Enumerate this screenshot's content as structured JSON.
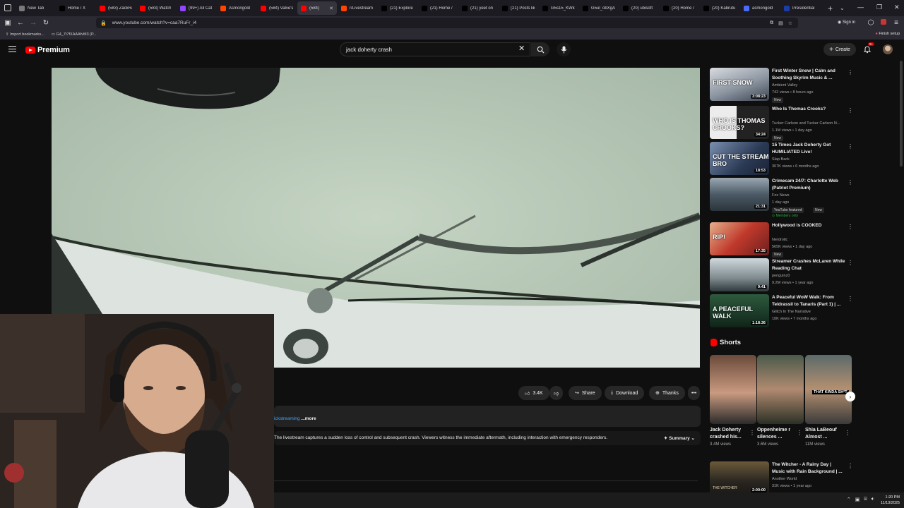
{
  "browser": {
    "tabs": [
      {
        "label": "New Tab",
        "color": "#7a7a7a",
        "active": false
      },
      {
        "label": "Home / X",
        "color": "#000000",
        "active": false
      },
      {
        "label": "(583) ZackRa",
        "color": "#ff0000",
        "active": false
      },
      {
        "label": "(583) Watch",
        "color": "#ff0000",
        "active": false
      },
      {
        "label": "(99+) All Cat",
        "color": "#9146ff",
        "active": false
      },
      {
        "label": "Asmongold",
        "color": "#ff4500",
        "active": false
      },
      {
        "label": "(584) Valve's",
        "color": "#ff0000",
        "active": false
      },
      {
        "label": "(584)",
        "color": "#ff0000",
        "active": true
      },
      {
        "label": "r/Livestream",
        "color": "#ff4500",
        "active": false
      },
      {
        "label": "(21) Explore",
        "color": "#000000",
        "active": false
      },
      {
        "label": "(21) Home /",
        "color": "#000000",
        "active": false
      },
      {
        "label": "(21) yeet on",
        "color": "#000000",
        "active": false
      },
      {
        "label": "(21) Posts lik",
        "color": "#000000",
        "active": false
      },
      {
        "label": "G5s15_KWk",
        "color": "#000000",
        "active": false
      },
      {
        "label": "G5ul_obXgA",
        "color": "#000000",
        "active": false
      },
      {
        "label": "(20) ubisoft",
        "color": "#000000",
        "active": false
      },
      {
        "label": "(20) Home /",
        "color": "#000000",
        "active": false
      },
      {
        "label": "(20) Kabrutu",
        "color": "#000000",
        "active": false
      },
      {
        "label": "asmongold",
        "color": "#4a6cf7",
        "active": false
      },
      {
        "label": "Presidential",
        "color": "#1a3da8",
        "active": false
      }
    ],
    "url": "www.youtube.com/watch?v=caa7RuFr_i4",
    "sign_in": "Sign in",
    "bookmarks": [
      "Import bookmarks...",
      "G4_7t7fXAAAfvM3 (P..."
    ],
    "finish_setup": "Finish setup"
  },
  "youtube": {
    "logo_text": "Premium",
    "search_query": "jack doherty crash",
    "create_label": "Create",
    "notif_count": "9+"
  },
  "video": {
    "actions": {
      "likes": "3.4K",
      "share": "Share",
      "download": "Download",
      "thanks": "Thanks"
    },
    "description_link": "ickstreaming",
    "description_more": " ...more",
    "summary_text": "The livestream captures a sudden loss of control and subsequent crash. Viewers witness the immediate aftermath, including interaction with emergency responders.",
    "summary_button": "Summary"
  },
  "recommendations": [
    {
      "title": "First Winter Snow | Calm and Soothing Skyrim Music & ...",
      "channel": "Ambient Valley",
      "meta": "742 views • 8 hours ago",
      "badge": "New",
      "duration": "3:08:23",
      "thumb_text": "FIRST SNOW"
    },
    {
      "title": "Who Is Thomas Crooks?",
      "channel": "Tucker Carlson and Tucker Carlson N...",
      "meta": "1.1M views • 1 day ago",
      "badge": "New",
      "duration": "34:24",
      "thumb_text": "WHO IS THOMAS CROOKS?"
    },
    {
      "title": "15 Times Jack Doherty Got HUMILIATED Live!",
      "channel": "Slap Back",
      "meta": "307K views • 6 months ago",
      "badge": "",
      "duration": "18:53",
      "thumb_text": "CUT THE STREAM BRO"
    },
    {
      "title": "Crimecam 24/7: Charlotte Web (Patriot Premium)",
      "channel": "Fox News",
      "meta": "1 day ago",
      "badge": "YouTube featured",
      "badge2": "New",
      "badge3": "Members only",
      "duration": "21:31",
      "thumb_text": ""
    },
    {
      "title": "Hollywood is COOKED",
      "channel": "Nerdrotic",
      "meta": "565K views • 1 day ago",
      "badge": "New",
      "duration": "17:35",
      "thumb_text": "RIP!"
    },
    {
      "title": "Streamer Crashes McLaren While Reading Chat",
      "channel": "penguinz0",
      "meta": "9.2M views • 1 year ago",
      "badge": "",
      "duration": "9:41",
      "thumb_text": ""
    },
    {
      "title": "A Peaceful WoW Walk: From Teldrassil to Tanaris (Part 1) | ...",
      "channel": "Glitch In The Narrative",
      "meta": "10K views • 7 months ago",
      "badge": "",
      "duration": "1:18:36",
      "thumb_text": "A PEACEFUL WALK"
    }
  ],
  "shorts": {
    "header": "Shorts",
    "items": [
      {
        "title": "Jack Doherty crashed his...",
        "views": "3.4M views",
        "thumb_text": ""
      },
      {
        "title": "Oppenheime r silences ...",
        "views": "3.6M views",
        "thumb_text": ""
      },
      {
        "title": "Shia LaBeouf Almost ...",
        "views": "11M views",
        "thumb_text": "THAT KINDA SH*T"
      }
    ]
  },
  "bottom_rec": {
    "title": "The Witcher - A Rainy Day | Music with Rain Background | ...",
    "channel": "Another World",
    "meta": "31K views • 1 year ago",
    "duration": "2:00:00",
    "thumb_text": "THE WITCHER"
  },
  "taskbar": {
    "time": "1:20 PM",
    "date": "11/13/2025"
  }
}
